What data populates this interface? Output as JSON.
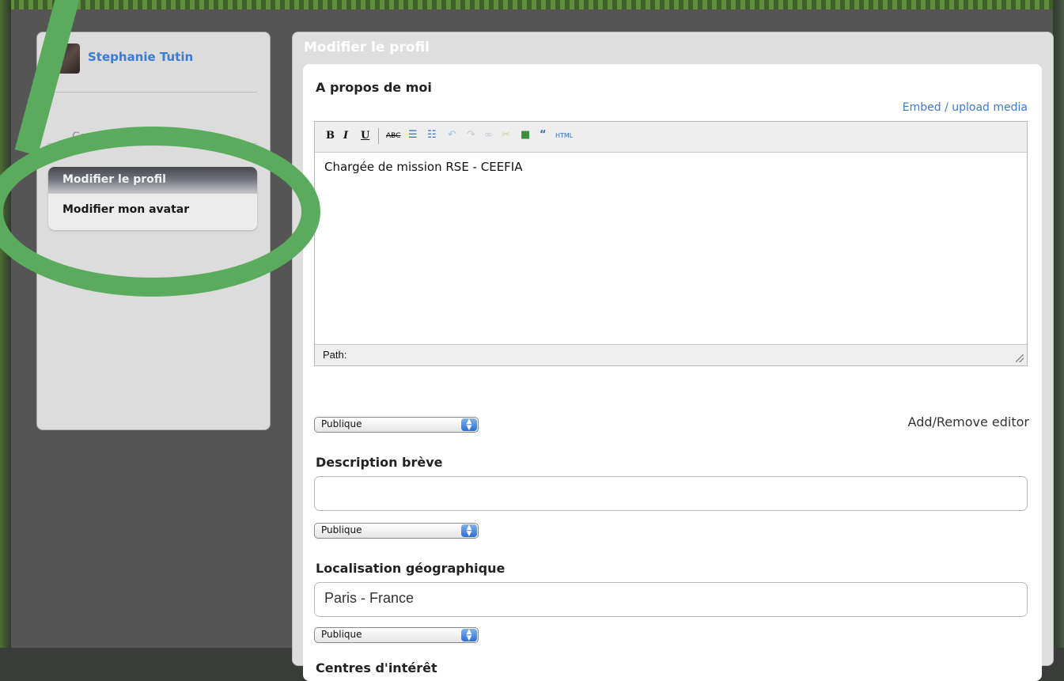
{
  "sidebar": {
    "user_name": "Stephanie Tutin",
    "contact_link": "Contact administrateur",
    "menu": {
      "edit_profile": "Modifier le profil",
      "edit_avatar": "Modifier mon avatar"
    }
  },
  "main": {
    "title": "Modifier le profil",
    "about": {
      "label": "A propos de moi",
      "embed_link": "Embed / upload media",
      "toolbar": {
        "bold": "B",
        "italic": "I",
        "underline": "U",
        "spellcheck": "ABC",
        "html": "HTML"
      },
      "content": "Chargée de mission RSE - CEEFIA",
      "path_label": "Path:",
      "visibility": "Publique",
      "add_remove_editor": "Add/Remove editor"
    },
    "short_description": {
      "label": "Description brève",
      "value": "",
      "visibility": "Publique"
    },
    "location": {
      "label": "Localisation géographique",
      "value": "Paris - France",
      "visibility": "Publique"
    },
    "interests": {
      "label": "Centres d'intérêt"
    }
  },
  "colors": {
    "link": "#3a7bd5",
    "annotation_green": "#5aab5e",
    "select_accent": "#2e6fd0"
  }
}
